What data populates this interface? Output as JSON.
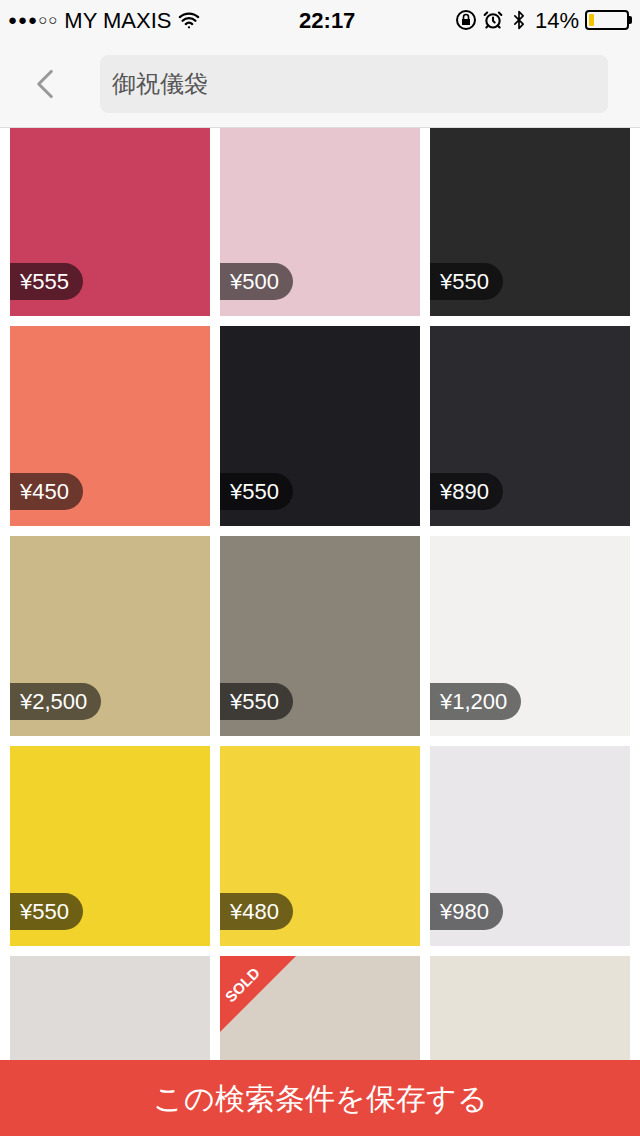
{
  "status_bar": {
    "signal": "●●●○○",
    "carrier": "MY MAXIS",
    "time": "22:17",
    "battery_text": "14%",
    "battery_level": 0.14
  },
  "search": {
    "value": "御祝儀袋"
  },
  "items": [
    {
      "price": "¥555",
      "sold": false,
      "color": "#c9405f"
    },
    {
      "price": "¥500",
      "sold": false,
      "color": "#e8c6cf"
    },
    {
      "price": "¥550",
      "sold": false,
      "color": "#2a2a2a"
    },
    {
      "price": "¥450",
      "sold": false,
      "color": "#f07b62"
    },
    {
      "price": "¥550",
      "sold": false,
      "color": "#1d1d22"
    },
    {
      "price": "¥890",
      "sold": false,
      "color": "#2b2a2f"
    },
    {
      "price": "¥2,500",
      "sold": false,
      "color": "#cbb98a"
    },
    {
      "price": "¥550",
      "sold": false,
      "color": "#8a8378"
    },
    {
      "price": "¥1,200",
      "sold": false,
      "color": "#f2f1ef"
    },
    {
      "price": "¥550",
      "sold": false,
      "color": "#f2d32b"
    },
    {
      "price": "¥480",
      "sold": false,
      "color": "#f3d43a"
    },
    {
      "price": "¥980",
      "sold": false,
      "color": "#e9e7ea"
    },
    {
      "price": "",
      "sold": false,
      "color": "#dedbd8"
    },
    {
      "price": "",
      "sold": true,
      "sold_label": "SOLD",
      "color": "#d8d0c4"
    },
    {
      "price": "",
      "sold": false,
      "color": "#e6e2d8"
    }
  ],
  "save_button": "この検索条件を保存する"
}
